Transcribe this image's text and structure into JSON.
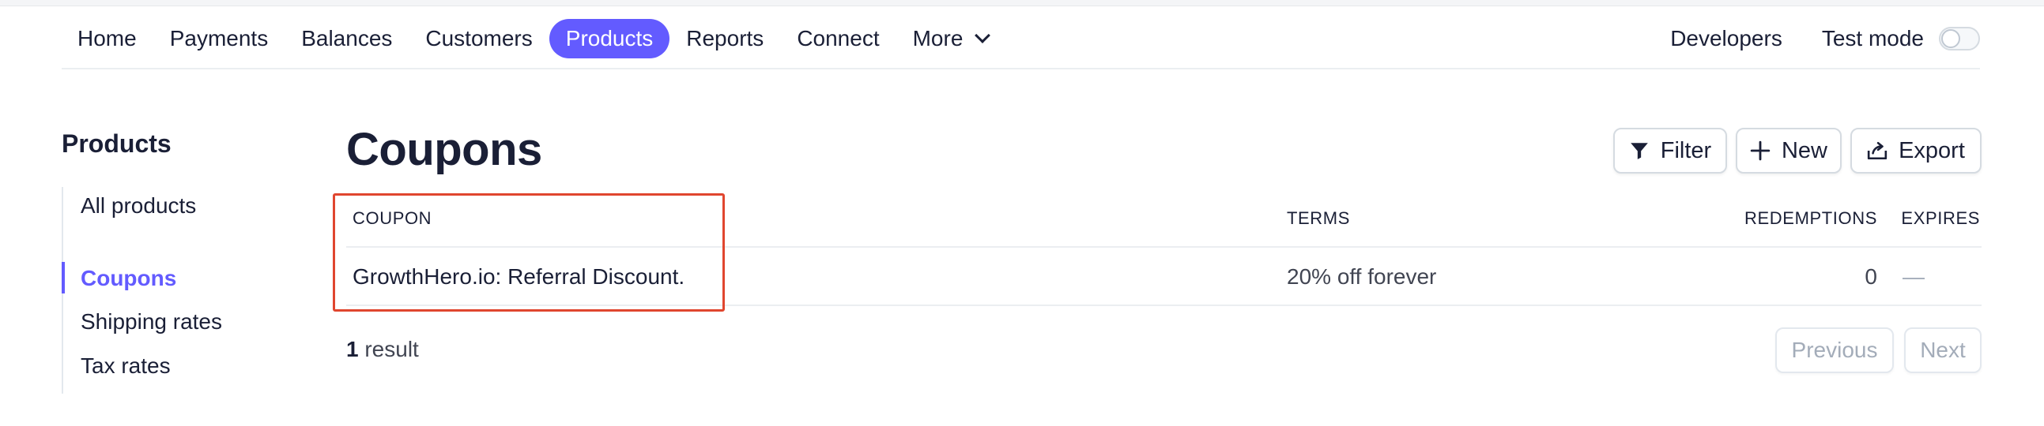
{
  "nav": {
    "items": [
      {
        "label": "Home",
        "active": false
      },
      {
        "label": "Payments",
        "active": false
      },
      {
        "label": "Balances",
        "active": false
      },
      {
        "label": "Customers",
        "active": false
      },
      {
        "label": "Products",
        "active": true
      },
      {
        "label": "Reports",
        "active": false
      },
      {
        "label": "Connect",
        "active": false
      }
    ],
    "more_label": "More",
    "developers_label": "Developers",
    "test_mode_label": "Test mode",
    "test_mode_on": false
  },
  "sidebar": {
    "title": "Products",
    "items": [
      {
        "label": "All products",
        "active": false
      },
      {
        "label": "Coupons",
        "active": true
      },
      {
        "label": "Shipping rates",
        "active": false
      },
      {
        "label": "Tax rates",
        "active": false
      }
    ]
  },
  "main": {
    "title": "Coupons",
    "actions": {
      "filter_label": "Filter",
      "new_label": "New",
      "export_label": "Export"
    },
    "table": {
      "columns": {
        "coupon": "COUPON",
        "terms": "TERMS",
        "redemptions": "REDEMPTIONS",
        "expires": "EXPIRES"
      },
      "rows": [
        {
          "coupon": "GrowthHero.io: Referral Discount.",
          "terms": "20% off forever",
          "redemptions": "0",
          "expires": "—"
        }
      ]
    },
    "result_count": "1",
    "result_suffix": " result",
    "pagination": {
      "previous_label": "Previous",
      "next_label": "Next"
    }
  },
  "colors": {
    "accent": "#635bff",
    "highlight_border": "#e0462f",
    "text_primary": "#1a1f36",
    "text_muted": "#a3acb9"
  }
}
